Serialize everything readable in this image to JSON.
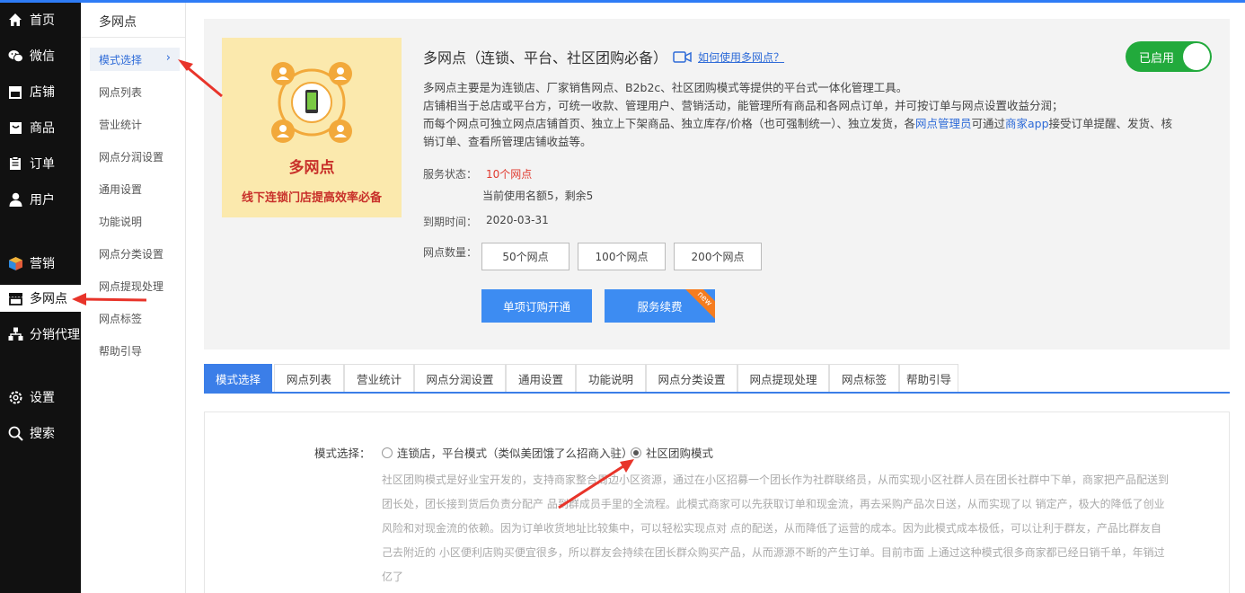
{
  "nav": {
    "items": [
      {
        "label": "首页",
        "icon": "home-icon"
      },
      {
        "label": "微信",
        "icon": "wechat-icon"
      },
      {
        "label": "店铺",
        "icon": "store-icon"
      },
      {
        "label": "商品",
        "icon": "box-icon"
      },
      {
        "label": "订单",
        "icon": "clipboard-icon"
      },
      {
        "label": "用户",
        "icon": "user-icon"
      },
      {
        "label": "营销",
        "icon": "cube-icon"
      },
      {
        "label": "多网点",
        "icon": "shop-front-icon"
      },
      {
        "label": "分销代理",
        "icon": "hierarchy-icon"
      },
      {
        "label": "设置",
        "icon": "gear-icon"
      },
      {
        "label": "搜索",
        "icon": "search-icon"
      }
    ]
  },
  "subnav": {
    "title": "多网点",
    "items": [
      "模式选择",
      "网点列表",
      "营业统计",
      "网点分润设置",
      "通用设置",
      "功能说明",
      "网点分类设置",
      "网点提现处理",
      "网点标签",
      "帮助引导"
    ]
  },
  "card": {
    "thumb_title": "多网点",
    "thumb_sub": "线下连锁门店提高效率必备",
    "heading": "多网点（连锁、平台、社区团购必备）",
    "help_link": "如何使用多网点？",
    "toggle_label": "已启用",
    "desc": {
      "line1": "多网点主要是为连锁店、厂家销售网点、B2b2c、社区团购模式等提供的平台式一体化管理工具。",
      "line2": "店铺相当于总店或平台方，可统一收款、管理用户、营销活动，能管理所有商品和各网点订单，并可按订单与网点设置收益分润；",
      "line3a": "而每个网点可独立网点店铺首页、独立上下架商品、独立库存/价格（也可强制统一）、独立发货，各",
      "line3_link1": "网点管理员",
      "line3b": "可通过",
      "line3_link2": "商家app",
      "line3c": "接受订单提醒、发货、核",
      "line4": "销订单、查看所管理店铺收益等。"
    },
    "service_status_label": "服务状态：",
    "service_status_value": "10个网点",
    "quota_text": "当前使用名额5，剩余5",
    "expire_label": "到期时间：",
    "expire_value": "2020-03-31",
    "qty_label": "网点数量：",
    "qty_options": [
      "50个网点",
      "100个网点",
      "200个网点"
    ],
    "buy_button": "单项订购开通",
    "renew_button": "服务续费",
    "renew_ribbon": "new"
  },
  "tabs": [
    "模式选择",
    "网点列表",
    "营业统计",
    "网点分润设置",
    "通用设置",
    "功能说明",
    "网点分类设置",
    "网点提现处理",
    "网点标签",
    "帮助引导"
  ],
  "mode": {
    "label": "模式选择：",
    "option1": "连锁店，平台模式（类似美团饿了么招商入驻）",
    "option2": "社区团购模式",
    "selected": "社区团购模式",
    "desc_lines": [
      "社区团购模式是好业宝开发的，支持商家整合周边小区资源，通过在小区招募一个团长作为社群联络员，从而实现小区社群人员在团长社群中下单，商家把产品配送到",
      "团长处，团长接到货后负责分配产 品到群成员手里的全流程。此模式商家可以先获取订单和现金流，再去采购产品次日送，从而实现了以 销定产，极大的降低了创业",
      "风险和对现金流的依赖。因为订单收货地址比较集中，可以轻松实现点对 点的配送，从而降低了运营的成本。因为此模式成本极低，可以让利于群友，产品比群友自",
      "己去附近的 小区便利店购买便宜很多，所以群友会持续在团长群众购买产品，从而源源不断的产生订单。目前市面 上通过这种模式很多商家都已经日销千单，年销过",
      "亿了"
    ]
  },
  "colors": {
    "accent": "#3b7ee8",
    "enabled": "#22aa3c",
    "danger": "#e03a2f",
    "annotation": "#e8342a"
  }
}
